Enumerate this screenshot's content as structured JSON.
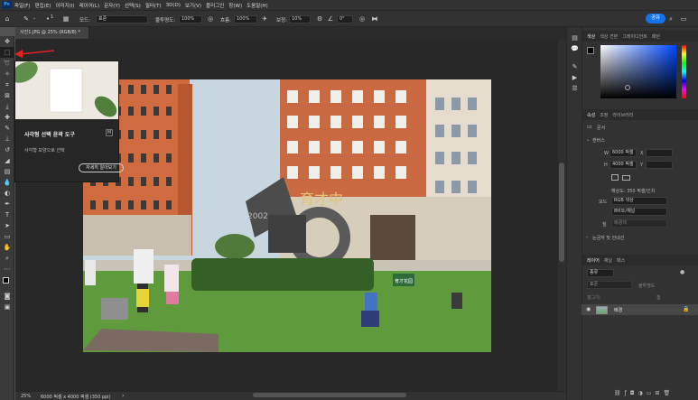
{
  "menubar": {
    "logo": "Ps",
    "items": [
      "파일(F)",
      "편집(E)",
      "이미지(I)",
      "레이어(L)",
      "문자(Y)",
      "선택(S)",
      "필터(T)",
      "3D(D)",
      "보기(V)",
      "플러그인",
      "창(W)",
      "도움말(H)"
    ]
  },
  "options": {
    "mode_label": "모드:",
    "mode_value": "표준",
    "opacity_label": "불투명도:",
    "opacity_value": "100%",
    "flow_label": "흐름:",
    "flow_value": "100%",
    "smooth_label": "보정:",
    "smooth_value": "10%",
    "angle_value": "0°",
    "brush_size": "1"
  },
  "share": {
    "label": "공유"
  },
  "document": {
    "tab_title": "사진1.JPG @ 25% (RGB/8) *"
  },
  "tooltip": {
    "title": "사각형 선택 윤곽 도구",
    "shortcut": "M",
    "description": "사각형 모양으로 선택",
    "learn_more": "자세히 알아보기"
  },
  "photo": {
    "school_sign": "育才中",
    "sculpture_number": "2002",
    "sign_text": "育才花园"
  },
  "statusbar": {
    "zoom": "25%",
    "dims": "6000 픽셀 x 4000 픽셀 (350 ppi)"
  },
  "panels": {
    "color_tabs": [
      "색상",
      "색상 견본",
      "그레이디언트",
      "패턴"
    ],
    "props_tabs": [
      "속성",
      "조정",
      "라이브러리"
    ],
    "doc_label": "문서",
    "canvas_section": "캔버스",
    "width_label": "W",
    "width_value": "6000 픽셀",
    "height_label": "H",
    "height_value": "4000 픽셀",
    "x_label": "X",
    "y_label": "Y",
    "resolution": "해상도: 350 픽셀/인치",
    "mode_label": "모드",
    "mode_value": "RGB 색상",
    "depth_value": "8비트/채널",
    "fill_label": "칠",
    "fill_value": "배경색",
    "rulers_section": "눈금자 및 안내선",
    "layers_tabs": [
      "레이어",
      "채널",
      "패스"
    ],
    "kind_placeholder": "종류",
    "blend_value": "표준",
    "opacity_label": "불투명도",
    "lock_label": "잠그기:",
    "fill2_label": "칠",
    "layer_name": "배경"
  },
  "colors": {
    "accent": "#1473e6",
    "arrow": "#e02424"
  }
}
